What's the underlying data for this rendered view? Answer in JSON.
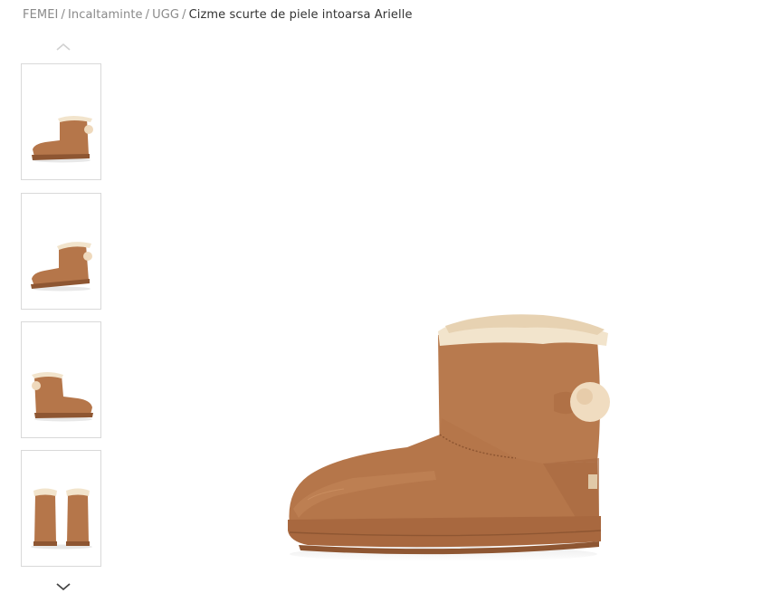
{
  "breadcrumb": {
    "items": [
      "FEMEI",
      "Incaltaminte",
      "UGG"
    ],
    "separator": "/",
    "current": "Cizme scurte de piele intoarsa Arielle"
  },
  "gallery": {
    "thumbnails": [
      {
        "view": "side-left"
      },
      {
        "view": "side-left-angled"
      },
      {
        "view": "side-right"
      },
      {
        "view": "back-pair"
      }
    ],
    "nav_up_icon": "chevron-up-icon",
    "nav_down_icon": "chevron-down-icon"
  },
  "product": {
    "main_image_view": "side-left",
    "colors": {
      "suede": "#b5764a",
      "suede_dark": "#8e5632",
      "fur": "#f2e4cc",
      "sole": "#a8683f"
    }
  }
}
